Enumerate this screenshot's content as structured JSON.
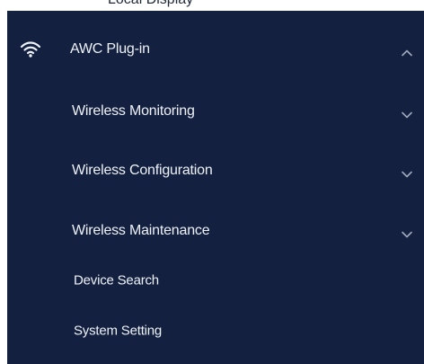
{
  "menu": {
    "top_fragment": "Local Display",
    "root": {
      "label": "AWC Plug-in",
      "icon": "wifi-icon",
      "expanded": true
    },
    "groups": [
      {
        "label": "Wireless Monitoring",
        "chevron": "chevron-down-icon"
      },
      {
        "label": "Wireless Configuration",
        "chevron": "chevron-down-icon"
      },
      {
        "label": "Wireless Maintenance",
        "chevron": "chevron-down-icon"
      }
    ],
    "leaves": [
      {
        "label": "Device Search"
      },
      {
        "label": "System Setting"
      }
    ]
  }
}
